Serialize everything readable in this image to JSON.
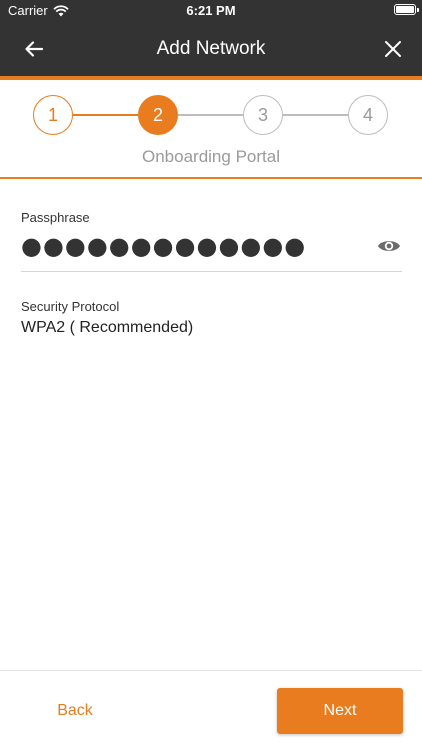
{
  "status_bar": {
    "carrier": "Carrier",
    "time": "6:21 PM",
    "wifi_icon": "wifi-icon",
    "battery_icon": "battery-icon"
  },
  "nav": {
    "title": "Add Network",
    "back_icon": "arrow-left-icon",
    "close_icon": "close-icon"
  },
  "stepper": {
    "steps": [
      {
        "label": "1",
        "state": "done"
      },
      {
        "label": "2",
        "state": "active"
      },
      {
        "label": "3",
        "state": "pending"
      },
      {
        "label": "4",
        "state": "pending"
      }
    ],
    "caption": "Onboarding Portal"
  },
  "form": {
    "passphrase": {
      "label": "Passphrase",
      "masked_value": "●●●●●●●●●●●●●",
      "toggle_icon": "eye-icon"
    },
    "security_protocol": {
      "label": "Security Protocol",
      "value": "WPA2 ( Recommended)"
    }
  },
  "footer": {
    "back_label": "Back",
    "next_label": "Next"
  },
  "colors": {
    "accent": "#e87c1e",
    "header": "#333333",
    "inactive": "#bdbdbd"
  }
}
